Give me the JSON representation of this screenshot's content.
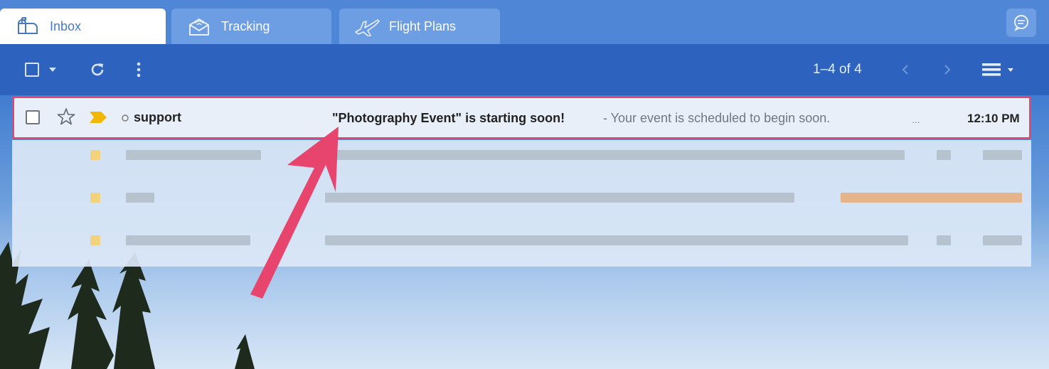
{
  "tabs": [
    {
      "label": "Inbox",
      "icon": "mailbox-icon",
      "active": true
    },
    {
      "label": "Tracking",
      "icon": "tracking-icon",
      "active": false
    },
    {
      "label": "Flight Plans",
      "icon": "airplane-icon",
      "active": false
    }
  ],
  "toolbar": {
    "pager": "1–4 of 4"
  },
  "messages": [
    {
      "sender": "support",
      "subject": "\"Photography Event\" is starting soon!",
      "snippet": " - Your event is scheduled to begin soon.",
      "ellipsis": "...",
      "time": "12:10 PM",
      "label_color": "#f2b705",
      "selected": true
    }
  ],
  "colors": {
    "accent": "#e0486f",
    "toolbar": "#2d62bf",
    "tabbar": "#4f86d6",
    "label": "#f2b705"
  }
}
